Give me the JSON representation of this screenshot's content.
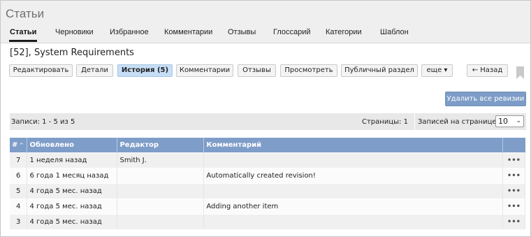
{
  "header": {
    "title": "Статьи",
    "tabs": [
      {
        "label": "Статьи",
        "active": true
      },
      {
        "label": "Черновики"
      },
      {
        "label": "Избранное"
      },
      {
        "label": "Комментарии"
      },
      {
        "label": "Отзывы"
      },
      {
        "label": "Глоссарий"
      },
      {
        "label": "Категории"
      },
      {
        "label": "Шаблон"
      }
    ]
  },
  "record": {
    "title": "[52], System Requirements"
  },
  "toolbar": {
    "edit": "Редактировать",
    "details": "Детали",
    "history": "История (5)",
    "comments": "Комментарии",
    "reviews": "Отзывы",
    "view": "Просмотреть",
    "public_section": "Публичный раздел",
    "more": "еще ▾",
    "back": "← Назад",
    "bookmark_icon": "bookmark-icon"
  },
  "actions": {
    "delete_all": "Удалить все ревизии"
  },
  "pager": {
    "records": "Записи: 1 - 5 из 5",
    "pages": "Страницы: 1",
    "per_page_label": "Записей на странице:",
    "per_page_value": "10"
  },
  "table": {
    "columns": {
      "num": "#",
      "sort_indicator": "^",
      "updated": "Обновлено",
      "editor": "Редактор",
      "comment": "Комментарий"
    },
    "rows": [
      {
        "num": "7",
        "updated": "1 неделя назад",
        "editor": "Smith J.",
        "comment": "",
        "menu": "•••"
      },
      {
        "num": "6",
        "updated": "6 года 1 месяц назад",
        "editor": "",
        "comment": "Automatically created revision!",
        "menu": "•••"
      },
      {
        "num": "5",
        "updated": "4 года 5 мес. назад",
        "editor": "",
        "comment": "",
        "menu": "•••"
      },
      {
        "num": "4",
        "updated": "4 года 5 мес. назад",
        "editor": "",
        "comment": "Adding another item",
        "menu": "•••"
      },
      {
        "num": "3",
        "updated": "4 года 5 мес. назад",
        "editor": "",
        "comment": "",
        "menu": "•••"
      }
    ]
  },
  "colors": {
    "accent": "#7e9dc8",
    "active_tab_button": "#c7dff6",
    "header_bg": "#efefef"
  }
}
